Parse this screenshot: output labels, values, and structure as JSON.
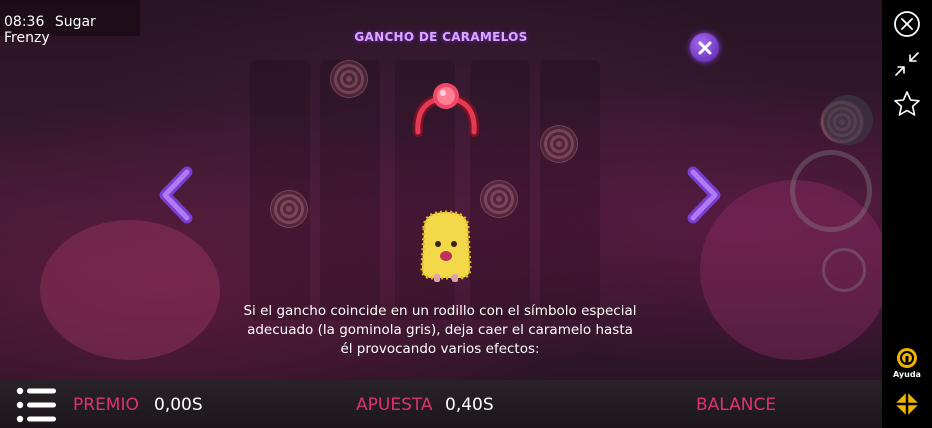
{
  "status": {
    "time": "08:36",
    "app_name": "Sugar Frenzy"
  },
  "popup": {
    "title": "GANCHO DE CARAMELOS",
    "description_lines": [
      "Si el gancho coincide en un rodillo con el símbolo especial",
      "adecuado (la gominola gris), deja caer el caramelo hasta",
      "él provocando varios efectos:"
    ]
  },
  "bottom_bar": {
    "prize_label": "PREMIO",
    "prize_value": "0,00S",
    "bet_label": "APUESTA",
    "bet_value": "0,40S",
    "balance_label": "BALANCE"
  },
  "side_panel": {
    "help_label": "Ayuda"
  },
  "colors": {
    "accent_pink": "#e0316e",
    "title_purple": "#d9a8ff",
    "button_purple": "#7a3fd0"
  },
  "icons": [
    "close-circle-icon",
    "minimize-icon",
    "star-icon",
    "close-popup-icon",
    "arrow-left-icon",
    "arrow-right-icon",
    "hamburger-menu-icon",
    "help-icon",
    "logo-icon"
  ]
}
